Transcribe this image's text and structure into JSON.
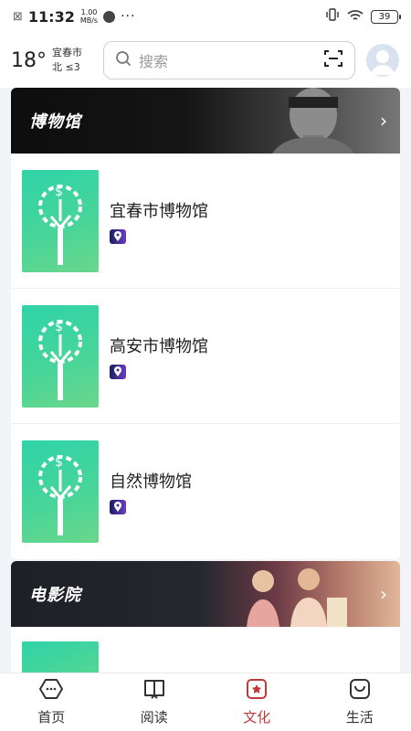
{
  "status_bar": {
    "time": "11:32",
    "net_speed_value": "1.00",
    "net_speed_unit": "MB/s",
    "more": "···",
    "battery": "39"
  },
  "header": {
    "temperature": "18°",
    "city": "宜春市",
    "wind": "北 ≤3",
    "search_placeholder": "搜索"
  },
  "sections": [
    {
      "title": "博物馆",
      "items": [
        {
          "name": "宜春市博物馆"
        },
        {
          "name": "高安市博物馆"
        },
        {
          "name": "自然博物馆"
        }
      ]
    },
    {
      "title": "电影院",
      "items": []
    }
  ],
  "nav": {
    "tabs": [
      {
        "label": "首页",
        "icon": "home-icon"
      },
      {
        "label": "阅读",
        "icon": "book-icon"
      },
      {
        "label": "文化",
        "icon": "culture-star-icon"
      },
      {
        "label": "生活",
        "icon": "life-bag-icon"
      }
    ],
    "active": "文化"
  },
  "colors": {
    "accent": "#c0393b",
    "thumb_green": "#3cd59f"
  }
}
